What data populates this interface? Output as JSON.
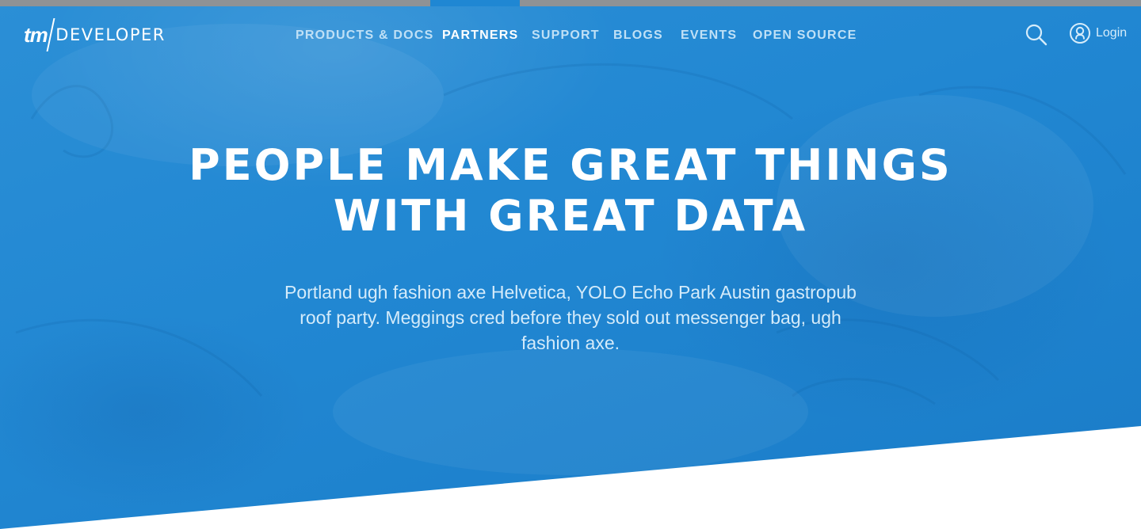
{
  "brand": {
    "logo_mark": "tm",
    "logo_word": "DEVELOPER"
  },
  "nav": {
    "items": [
      {
        "label": "PRODUCTS & DOCS",
        "active": false
      },
      {
        "label": "PARTNERS",
        "active": true
      },
      {
        "label": "SUPPORT",
        "active": false
      },
      {
        "label": "BLOGS",
        "active": false
      },
      {
        "label": "EVENTS",
        "active": false
      },
      {
        "label": "OPEN SOURCE",
        "active": false
      }
    ]
  },
  "header": {
    "search_icon": "search-icon",
    "login_icon": "user-circle-icon",
    "login_label": "Login"
  },
  "hero": {
    "headline_line1": "PEOPLE MAKE GREAT THINGS",
    "headline_line2": "WITH GREAT DATA",
    "subtext": "Portland ugh fashion axe Helvetica, YOLO Echo Park Austin gastropub roof party. Meggings cred before they sold out messenger bag, ugh fashion axe."
  },
  "colors": {
    "hero_blue": "#2187d2",
    "topbar_gray": "#8f9295",
    "topbar_active": "#1f87d3",
    "nav_text": "#bfe0f6",
    "nav_active_text": "#ffffff"
  }
}
